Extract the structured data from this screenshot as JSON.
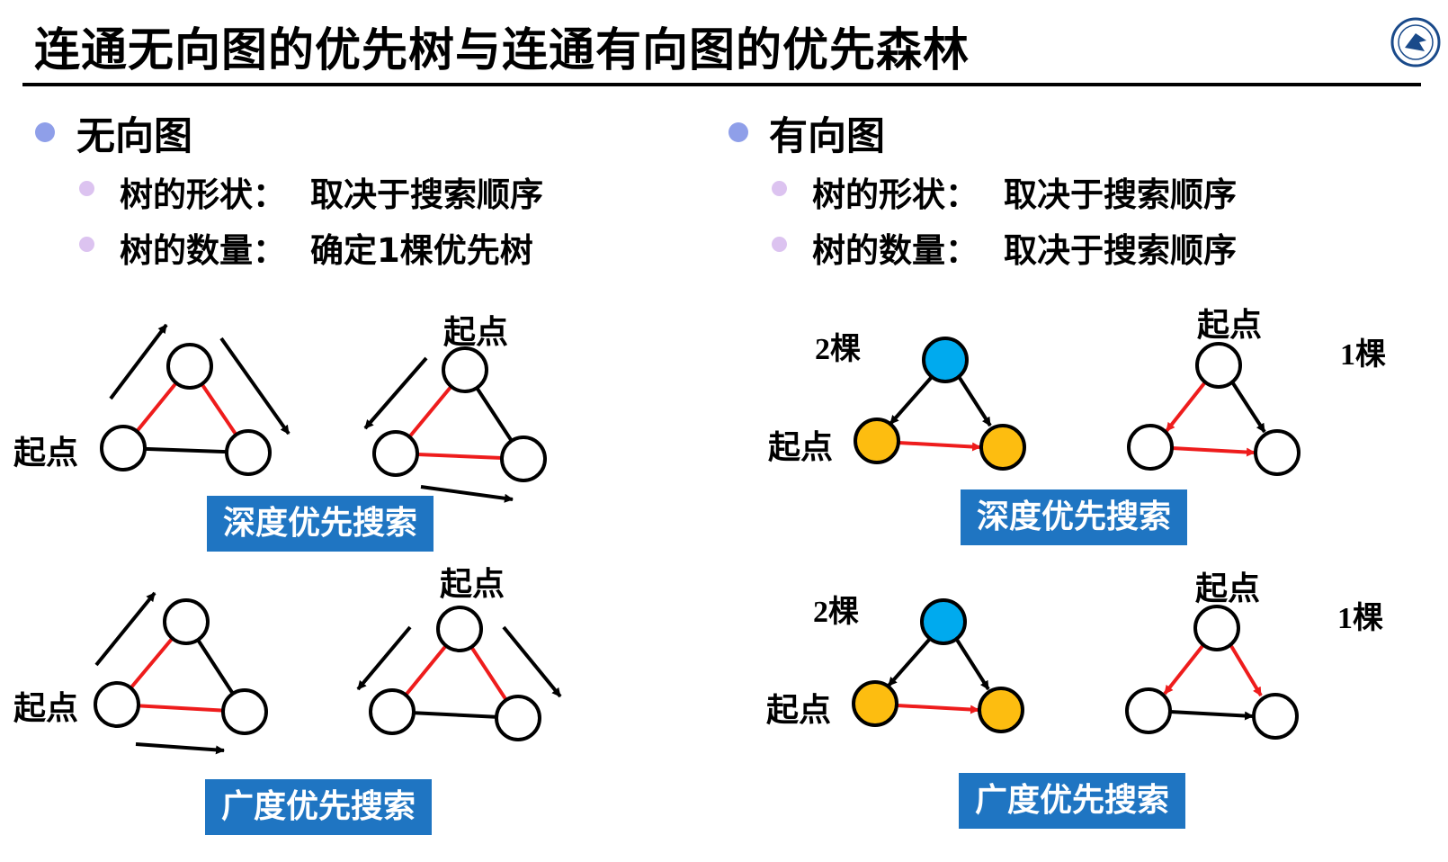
{
  "slide": {
    "title": "连通无向图的优先树与连通有向图的优先森林",
    "logo_icon": "university-seal-icon"
  },
  "left": {
    "heading": "无向图",
    "items": [
      {
        "label": "树的形状：",
        "value": "取决于搜索顺序"
      },
      {
        "label": "树的数量：",
        "value": "确定1棵优先树"
      }
    ],
    "start_label": "起点",
    "dfs_label": "深度优先搜索",
    "bfs_label": "广度优先搜索"
  },
  "right": {
    "heading": "有向图",
    "items": [
      {
        "label": "树的形状：",
        "value": "取决于搜索顺序"
      },
      {
        "label": "树的数量：",
        "value": "取决于搜索顺序"
      }
    ],
    "start_label": "起点",
    "count_two": "2棵",
    "count_one": "1棵",
    "dfs_label": "深度优先搜索",
    "bfs_label": "广度优先搜索"
  },
  "colors": {
    "tree_edge": "#ee1c1c",
    "edge": "#000000",
    "root_blue": "#00aaee",
    "node_orange": "#fdbd10",
    "badge": "#1f75c2"
  }
}
